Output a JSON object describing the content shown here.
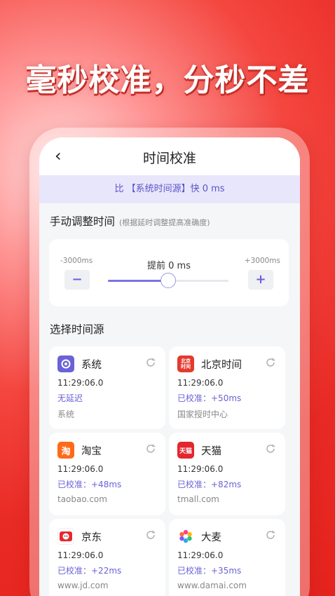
{
  "headline": "毫秒校准，分秒不差",
  "nav": {
    "back_label": "‹",
    "title": "时间校准"
  },
  "banner": {
    "text": "比 【系统时间源】快 0 ms"
  },
  "manual": {
    "title": "手动调整时间",
    "hint": "(根据延时调整提高准确度)",
    "min_label": "-3000ms",
    "max_label": "+3000ms",
    "center_label": "提前 0 ms",
    "minus": "−",
    "plus": "+",
    "slider_fraction": 0.5
  },
  "sources": {
    "title": "选择时间源",
    "items": [
      {
        "name": "系统",
        "time": "11:29:06.0",
        "status": "无延迟",
        "domain": "系统",
        "logo_text": "",
        "color": "#6a62d6",
        "selected": true
      },
      {
        "name": "北京时间",
        "time": "11:29:06.0",
        "status": "已校准：+50ms",
        "domain": "国家授时中心",
        "logo_text": "北京\n时间",
        "color": "#e33a2d",
        "selected": false
      },
      {
        "name": "淘宝",
        "time": "11:29:06.0",
        "status": "已校准：+48ms",
        "domain": "taobao.com",
        "logo_text": "淘",
        "color": "#ff6a1a",
        "selected": false
      },
      {
        "name": "天猫",
        "time": "11:29:06.0",
        "status": "已校准：+82ms",
        "domain": "tmall.com",
        "logo_text": "天猫",
        "color": "#e3262e",
        "selected": false
      },
      {
        "name": "京东",
        "time": "11:29:06.0",
        "status": "已校准：+22ms",
        "domain": "www.jd.com",
        "logo_text": "",
        "color": "#e9262b",
        "selected": false
      },
      {
        "name": "大麦",
        "time": "11:29:06.0",
        "status": "已校准：+35ms",
        "domain": "www.damai.com",
        "logo_text": "",
        "color": "#ff3d8b",
        "selected": false
      }
    ]
  }
}
